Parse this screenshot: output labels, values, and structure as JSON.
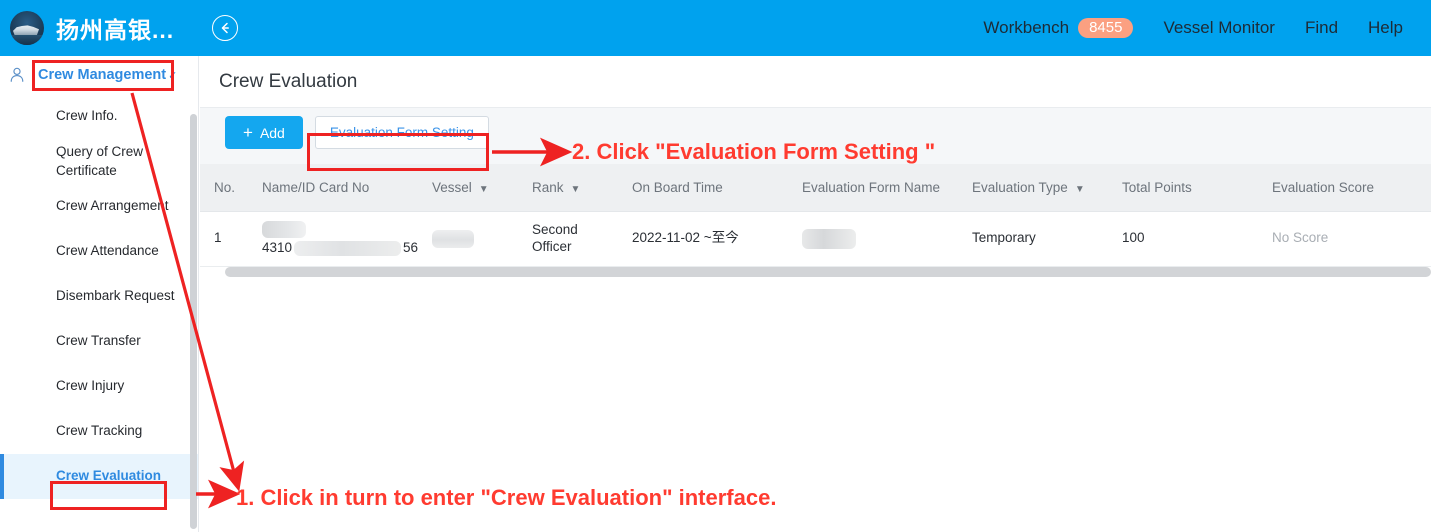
{
  "header": {
    "logo_icon": "ship-logo-icon",
    "brand": "扬州高银...",
    "back_icon": "circle-back-arrow-icon",
    "nav": [
      {
        "label": "Workbench",
        "badge": "8455"
      },
      {
        "label": "Vessel Monitor",
        "badge": null
      },
      {
        "label": "Find",
        "badge": null
      },
      {
        "label": "Help",
        "badge": null
      }
    ],
    "badge_color": "#fba081",
    "bar_color": "#00a2ee"
  },
  "sidebar": {
    "group_icon": "person-icon",
    "group_label": "Crew Management",
    "group_chevron": "chevron-down-icon",
    "items": [
      {
        "label": "Crew Info.",
        "selected": false
      },
      {
        "label": "Query of Crew Certificate",
        "selected": false
      },
      {
        "label": "Crew Arrangement",
        "selected": false
      },
      {
        "label": "Crew Attendance",
        "selected": false
      },
      {
        "label": "Disembark Request",
        "selected": false
      },
      {
        "label": "Crew Transfer",
        "selected": false
      },
      {
        "label": "Crew Injury",
        "selected": false
      },
      {
        "label": "Crew Tracking",
        "selected": false
      },
      {
        "label": "Crew Evaluation",
        "selected": true
      }
    ],
    "accent_color": "#2f8ae0",
    "selected_bg": "#e8f4fd"
  },
  "main": {
    "page_title": "Crew Evaluation",
    "toolbar": {
      "add_label": "Add",
      "add_plus": "+",
      "form_setting_label": "Evaluation Form Setting",
      "add_color": "#14a7ef"
    },
    "table": {
      "columns": [
        {
          "label": "No.",
          "sortable": false
        },
        {
          "label": "Name/ID Card No",
          "sortable": false
        },
        {
          "label": "Vessel",
          "sortable": true
        },
        {
          "label": "Rank",
          "sortable": true
        },
        {
          "label": "On Board Time",
          "sortable": false
        },
        {
          "label": "Evaluation Form Name",
          "sortable": false
        },
        {
          "label": "Evaluation Type",
          "sortable": true
        },
        {
          "label": "Total Points",
          "sortable": false
        },
        {
          "label": "Evaluation Score",
          "sortable": false
        }
      ],
      "rows": [
        {
          "no": "1",
          "name_redacted": true,
          "id_prefix": "4310",
          "id_suffix": "56",
          "vessel_redacted": true,
          "rank": "Second Officer",
          "on_board_time": "2022-11-02 ~至今",
          "form_name_redacted": true,
          "evaluation_type": "Temporary",
          "total_points": "100",
          "evaluation_score": "No Score"
        }
      ]
    }
  },
  "annotations": {
    "color": "#ff3b30",
    "step1": "1. Click in turn to enter \"Crew Evaluation\" interface.",
    "step2": "2. Click \"Evaluation Form Setting \""
  }
}
